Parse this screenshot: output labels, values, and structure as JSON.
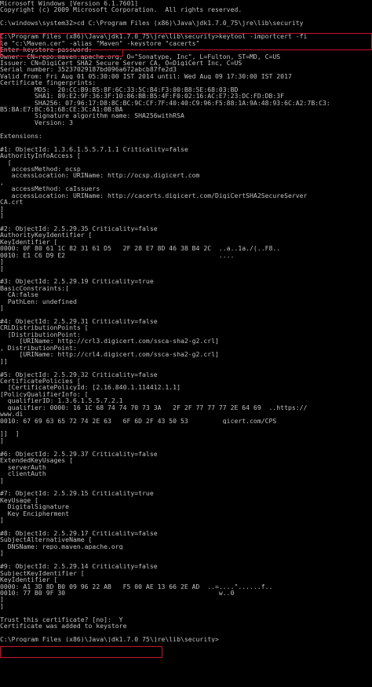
{
  "window": {
    "type": "command-prompt",
    "background_color": "#000000",
    "text_color": "#c0c0c0",
    "highlight_color": "#c8102e"
  },
  "lines": [
    "Microsoft Windows [Version 6.1.7601]",
    "Copyright (c) 2009 Microsoft Corporation.  All rights reserved.",
    "",
    "C:\\windows\\system32>cd C:\\Program Files (x86)\\Java\\jdk1.7.0_75\\jre\\lib\\security",
    "",
    "C:\\Program Files (x86)\\Java\\jdk1.7.0_75\\jre\\lib\\security>keytool -importcert -fi",
    "le \"c:\\Maven.cer\" -alias \"Maven\" -keystore \"cacerts\"",
    "Enter keystore password:",
    "Owner: CN=repo.maven.apache.org, O=\"Sonatype, Inc\", L=Fulton, ST=MD, C=US",
    "Issuer: CN=DigiCert SHA2 Secure Server CA, O=DigiCert Inc, C=US",
    "Serial number: 35237029187bd096a672abcb87fe2d3",
    "Valid from: Fri Aug 01 05:30:00 IST 2014 until: Wed Aug 09 17:30:00 IST 2017",
    "Certificate fingerprints:",
    "         MD5:  20:CC:B9:B5:8F:6C:33:5C:B4:F3:00:B8:5E:68:03:BD",
    "         SHA1: 89:E2:9F:36:3F:10:86:BB:B5:4F:F0:02:16:AC:E7:23:DC:FD:DB:3F",
    "         SHA256: 07:96:17:D8:8C:BC:9C:CF:7F:40:40:C9:96:F5:88:1A:9A:48:93:6C:A2:7B:C3:",
    "B5:BA:E7:BC:61:68:CE:3C:A1:0B:BA",
    "         Signature algorithm name: SHA256withRSA",
    "         Version: 3",
    "",
    "Extensions:",
    "",
    "#1: ObjectId: 1.3.6.1.5.5.7.1.1 Criticality=false",
    "AuthorityInfoAccess [",
    "  [",
    "   accessMethod: ocsp",
    "   accessLocation: URIName: http://ocsp.digicert.com",
    ",",
    "   accessMethod: caIssuers",
    "   accessLocation: URIName: http://cacerts.digicert.com/DigiCertSHA2SecureServer",
    "CA.crt",
    "]",
    "]",
    "",
    "#2: ObjectId: 2.5.29.35 Criticality=false",
    "AuthorityKeyIdentifier [",
    "KeyIdentifier [",
    "0000: 0F 80 61 1C 82 31 61 D5   2F 28 E7 8D 46 38 B4 2C  ..a..1a./(..F8..",
    "0010: E1 C6 D9 E2                                        ....",
    "]",
    "]",
    "",
    "#3: ObjectId: 2.5.29.19 Criticality=true",
    "BasicConstraints:[",
    "  CA:false",
    "  PathLen: undefined",
    "]",
    "",
    "#4: ObjectId: 2.5.29.31 Criticality=false",
    "CRLDistributionPoints [",
    "  [DistributionPoint:",
    "     [URIName: http://crl3.digicert.com/ssca-sha2-g2.crl]",
    ", DistributionPoint:",
    "     [URIName: http://crl4.digicert.com/ssca-sha2-g2.crl]",
    "]]",
    "",
    "#5: ObjectId: 2.5.29.32 Criticality=false",
    "CertificatePolicies [",
    "  [CertificatePolicyId: [2.16.840.1.114412.1.1]",
    "[PolicyQualifierInfo: [",
    "  qualifierID: 1.3.6.1.5.5.7.2.1",
    "  qualifier: 0000: 16 1C 68 74 74 70 73 3A   2F 2F 77 77 77 2E 64 69  ..https://",
    "www.di",
    "0010: 67 69 63 65 72 74 2E 63   6F 6D 2F 43 50 53         gicert.com/CPS",
    "",
    "]]  ]",
    "]",
    "",
    "#6: ObjectId: 2.5.29.37 Criticality=false",
    "ExtendedKeyUsages [",
    "  serverAuth",
    "  clientAuth",
    "]",
    "",
    "#7: ObjectId: 2.5.29.15 Criticality=true",
    "KeyUsage [",
    "  DigitalSignature",
    "  Key_Encipherment",
    "]",
    "",
    "#8: ObjectId: 2.5.29.17 Criticality=false",
    "SubjectAlternativeName [",
    "  DNSName: repo.maven.apache.org",
    "]",
    "",
    "#9: ObjectId: 2.5.29.14 Criticality=false",
    "SubjectKeyIdentifier [",
    "KeyIdentifier [",
    "0000: A1 3D 8D B0 09 96 22 AB   F5 00 AE 13 66 2E AD  ..=....\"......f..",
    "0010: 77 B0 9F 30                                        w..0",
    "]",
    "]",
    "",
    "Trust this certificate? [no]:  Y",
    "Certificate was added to keystore",
    "",
    "C:\\Program Files (x86)\\Java\\jdk1.7.0_75\\jre\\lib\\security>"
  ]
}
